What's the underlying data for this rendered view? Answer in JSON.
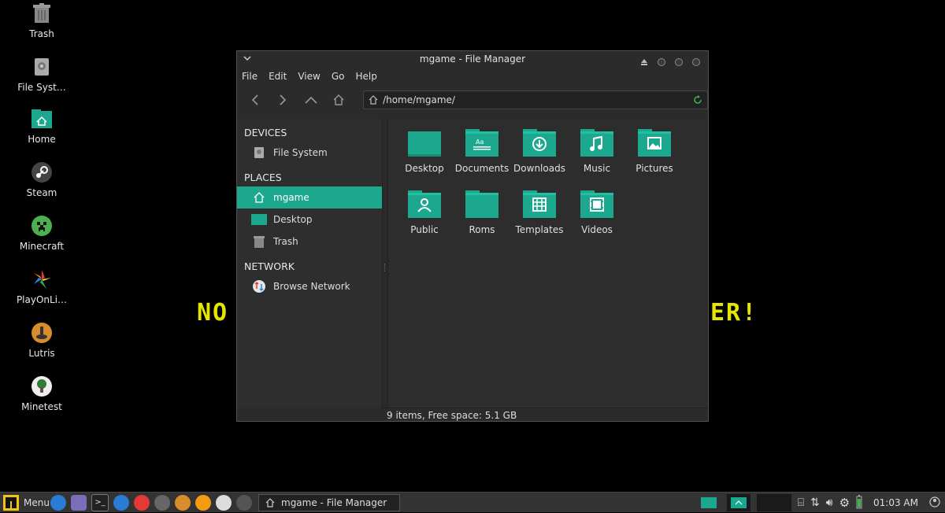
{
  "desktop": {
    "icons": [
      {
        "label": "Trash",
        "icon": "trash-icon"
      },
      {
        "label": "File Syst…",
        "icon": "drive-icon"
      },
      {
        "label": "Home",
        "icon": "home-folder-icon"
      },
      {
        "label": "Steam",
        "icon": "steam-icon"
      },
      {
        "label": "Minecraft",
        "icon": "minecraft-icon"
      },
      {
        "label": "PlayOnLi…",
        "icon": "playonlinux-icon"
      },
      {
        "label": "Lutris",
        "icon": "lutris-icon"
      },
      {
        "label": "Minetest",
        "icon": "minetest-icon"
      }
    ],
    "banner_left": "NO",
    "banner_right": "ER!"
  },
  "window": {
    "title": "mgame - File Manager",
    "menu": [
      "File",
      "Edit",
      "View",
      "Go",
      "Help"
    ],
    "path": "/home/mgame/",
    "sidebar": {
      "devices_header": "DEVICES",
      "devices": [
        {
          "label": "File System",
          "icon": "drive-icon"
        }
      ],
      "places_header": "PLACES",
      "places": [
        {
          "label": "mgame",
          "icon": "home-icon"
        },
        {
          "label": "Desktop",
          "icon": "desktop-icon"
        },
        {
          "label": "Trash",
          "icon": "trash-icon"
        }
      ],
      "network_header": "NETWORK",
      "network": [
        {
          "label": "Browse Network",
          "icon": "network-icon"
        }
      ]
    },
    "files": [
      {
        "label": "Desktop",
        "icon": "desktop-folder-icon"
      },
      {
        "label": "Documents",
        "icon": "documents-folder-icon"
      },
      {
        "label": "Downloads",
        "icon": "downloads-folder-icon"
      },
      {
        "label": "Music",
        "icon": "music-folder-icon"
      },
      {
        "label": "Pictures",
        "icon": "pictures-folder-icon"
      },
      {
        "label": "Public",
        "icon": "public-folder-icon"
      },
      {
        "label": "Roms",
        "icon": "folder-icon"
      },
      {
        "label": "Templates",
        "icon": "templates-folder-icon"
      },
      {
        "label": "Videos",
        "icon": "videos-folder-icon"
      }
    ],
    "status": "9 items, Free space: 5.1 GB"
  },
  "taskbar": {
    "menu_label": "Menu",
    "task_label": "mgame - File Manager",
    "clock": "01:03 AM"
  },
  "colors": {
    "accent": "#1ba88e",
    "banner": "#e5e500"
  }
}
